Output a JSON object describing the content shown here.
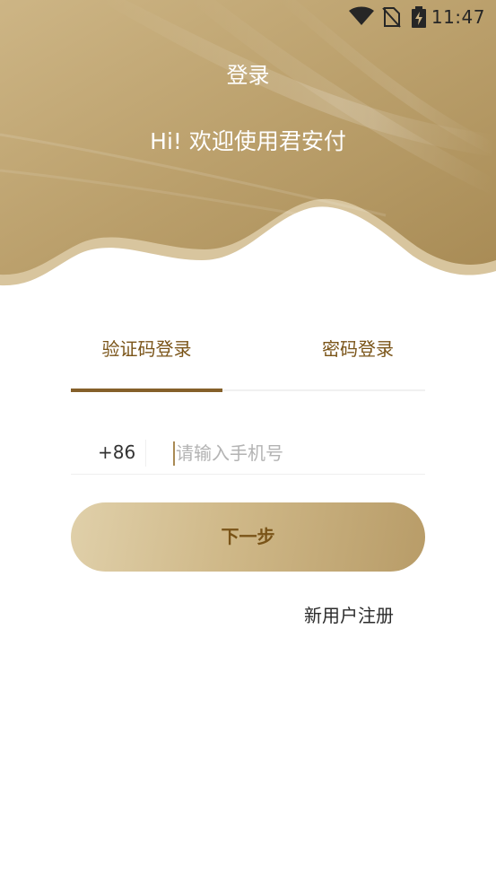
{
  "status_bar": {
    "time": "11:47",
    "icons": [
      "wifi-icon",
      "no-sim-icon",
      "battery-charging-icon"
    ]
  },
  "header": {
    "title": "登录",
    "welcome": "Hi! 欢迎使用君安付"
  },
  "tabs": {
    "sms_login": "验证码登录",
    "password_login": "密码登录",
    "active": "sms_login"
  },
  "phone": {
    "country_code": "+86",
    "placeholder": "请输入手机号",
    "value": ""
  },
  "actions": {
    "next_label": "下一步",
    "register_label": "新用户注册"
  },
  "colors": {
    "gold_light": "#e0d0aa",
    "gold_dark": "#b89c68",
    "accent_text": "#7a5418",
    "indicator": "#85602a"
  }
}
